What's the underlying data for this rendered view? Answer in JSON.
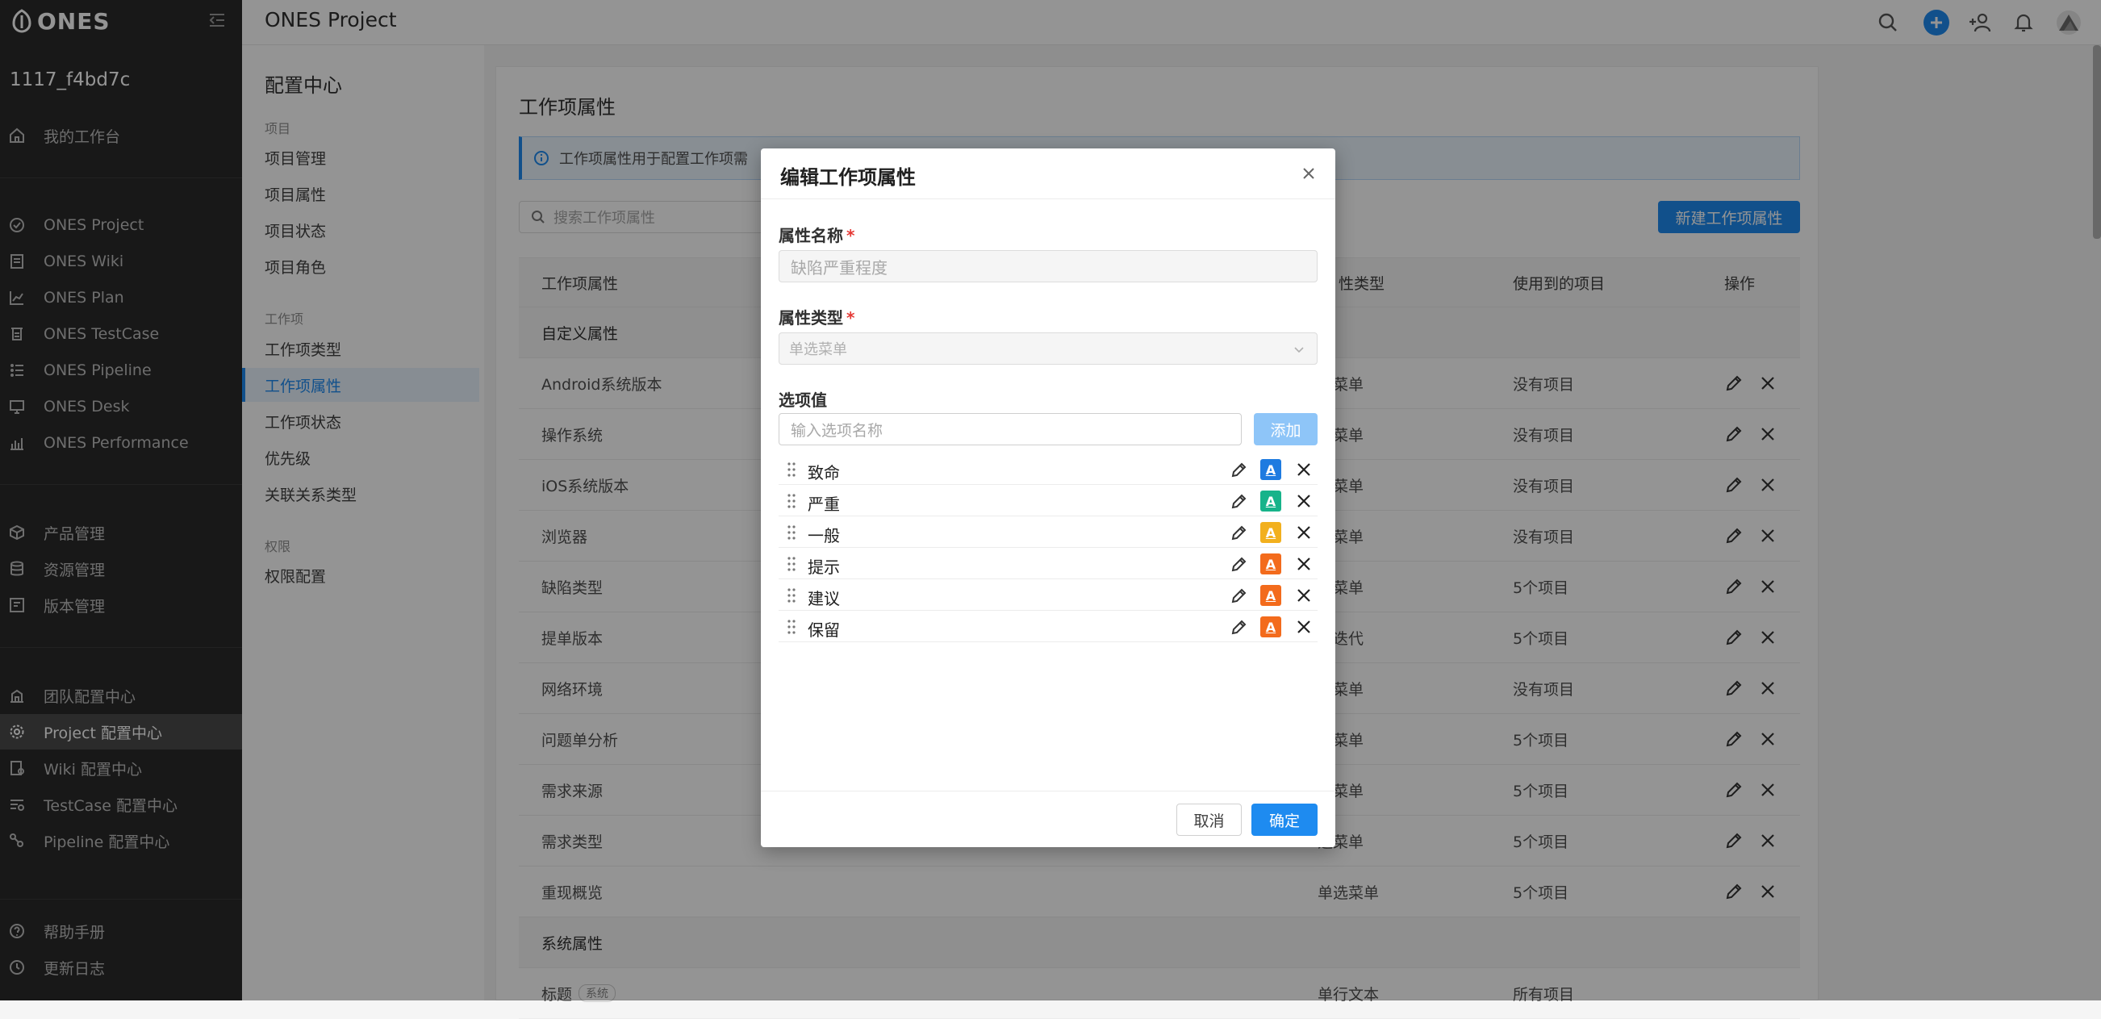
{
  "brand": {
    "logo_text": "ONES"
  },
  "sidebar": {
    "org_name": "1117_f4bd7c",
    "workbench": "我的工作台",
    "products": [
      {
        "label": "ONES Project",
        "icon": "check-circle-icon"
      },
      {
        "label": "ONES Wiki",
        "icon": "wiki-icon"
      },
      {
        "label": "ONES Plan",
        "icon": "plan-chart-icon"
      },
      {
        "label": "ONES TestCase",
        "icon": "testcase-icon"
      },
      {
        "label": "ONES Pipeline",
        "icon": "pipeline-icon"
      },
      {
        "label": "ONES Desk",
        "icon": "desk-monitor-icon"
      },
      {
        "label": "ONES Performance",
        "icon": "performance-chart-icon"
      }
    ],
    "management": [
      {
        "label": "产品管理",
        "icon": "cube-icon"
      },
      {
        "label": "资源管理",
        "icon": "database-icon"
      },
      {
        "label": "版本管理",
        "icon": "version-icon"
      }
    ],
    "config": [
      {
        "label": "团队配置中心",
        "icon": "team-icon"
      },
      {
        "label": "Project 配置中心",
        "icon": "gear-icon"
      },
      {
        "label": "Wiki 配置中心",
        "icon": "wiki-config-icon"
      },
      {
        "label": "TestCase 配置中心",
        "icon": "testcase-config-icon"
      },
      {
        "label": "Pipeline 配置中心",
        "icon": "pipeline-config-icon"
      }
    ],
    "help": [
      {
        "label": "帮助手册",
        "icon": "help-icon"
      },
      {
        "label": "更新日志",
        "icon": "changelog-icon"
      }
    ]
  },
  "topbar": {
    "title": "ONES Project"
  },
  "config_nav": {
    "title": "配置中心",
    "group_project": "项目",
    "project_items": [
      "项目管理",
      "项目属性",
      "项目状态",
      "项目角色"
    ],
    "group_workitem": "工作项",
    "workitem_items": [
      "工作项类型",
      "工作项属性",
      "工作项状态",
      "优先级",
      "关联关系类型"
    ],
    "group_perm": "权限",
    "perm_items": [
      "权限配置"
    ]
  },
  "main": {
    "title": "工作项属性",
    "info": "工作项属性用于配置工作项需",
    "search_placeholder": "搜索工作项属性",
    "new_button": "新建工作项属性",
    "columns": {
      "name": "工作项属性",
      "type": "性类型",
      "projects": "使用到的项目",
      "actions": "操作"
    },
    "group_custom": "自定义属性",
    "rows": [
      {
        "name": "Android系统版本",
        "type": "选菜单",
        "projects": "没有项目"
      },
      {
        "name": "操作系统",
        "type": "选菜单",
        "projects": "没有项目"
      },
      {
        "name": "iOS系统版本",
        "type": "选菜单",
        "projects": "没有项目"
      },
      {
        "name": "浏览器",
        "type": "选菜单",
        "projects": "没有项目"
      },
      {
        "name": "缺陷类型",
        "type": "选菜单",
        "projects": "5个项目"
      },
      {
        "name": "提单版本",
        "type": "选迭代",
        "projects": "5个项目"
      },
      {
        "name": "网络环境",
        "type": "选菜单",
        "projects": "没有项目"
      },
      {
        "name": "问题单分析",
        "type": "选菜单",
        "projects": "5个项目"
      },
      {
        "name": "需求来源",
        "type": "选菜单",
        "projects": "5个项目"
      },
      {
        "name": "需求类型",
        "type": "选菜单",
        "projects": "5个项目"
      },
      {
        "name": "重现概览",
        "type": "单选菜单",
        "projects": "5个项目"
      }
    ],
    "group_system": "系统属性",
    "system_row": {
      "name": "标题",
      "badge": "系统",
      "type": "单行文本",
      "projects": "所有项目"
    }
  },
  "modal": {
    "title": "编辑工作项属性",
    "name_label": "属性名称",
    "name_value": "缺陷严重程度",
    "type_label": "属性类型",
    "type_value": "单选菜单",
    "options_label": "选项值",
    "option_placeholder": "输入选项名称",
    "add_button": "添加",
    "options": [
      {
        "name": "致命",
        "color": "#1e7be0",
        "color_icon": "A"
      },
      {
        "name": "严重",
        "color": "#17b38a",
        "color_icon": "A"
      },
      {
        "name": "一般",
        "color": "#f2b01e",
        "color_icon": "A"
      },
      {
        "name": "提示",
        "color": "#f36b1c",
        "color_icon": "A"
      },
      {
        "name": "建议",
        "color": "#f36b1c",
        "color_icon": "A"
      },
      {
        "name": "保留",
        "color": "#f36b1c",
        "color_icon": "A"
      }
    ],
    "cancel": "取消",
    "confirm": "确定"
  }
}
